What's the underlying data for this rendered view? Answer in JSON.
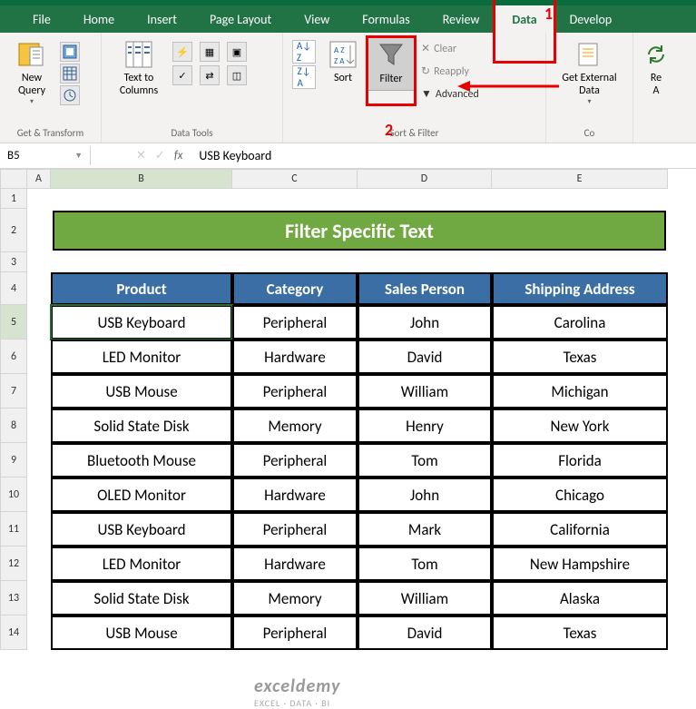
{
  "ribbon": {
    "tabs": [
      "File",
      "Home",
      "Insert",
      "Page Layout",
      "View",
      "Formulas",
      "Review",
      "Data",
      "Develop"
    ],
    "active_tab": "Data",
    "groups": {
      "get_transform": {
        "label": "Get & Transform",
        "new_query": "New\nQuery"
      },
      "data_tools": {
        "label": "Data Tools",
        "text_to_columns": "Text to\nColumns"
      },
      "sort_filter": {
        "label": "Sort & Filter",
        "sort": "Sort",
        "filter": "Filter",
        "clear": "Clear",
        "reapply": "Reapply",
        "advanced": "Advanced"
      },
      "get_external": {
        "label": "Co",
        "btn": "Get External\nData"
      },
      "refresh": {
        "label": "",
        "btn": "Re\nA"
      }
    }
  },
  "annotations": {
    "one": "1",
    "two": "2"
  },
  "name_box": "B5",
  "formula_value": "USB Keyboard",
  "columns": [
    "A",
    "B",
    "C",
    "D",
    "E"
  ],
  "row_count": 14,
  "selected_row": 5,
  "sheet_title": "Filter Specific Text",
  "table": {
    "headers": [
      "Product",
      "Category",
      "Sales Person",
      "Shipping Address"
    ],
    "rows": [
      [
        "USB Keyboard",
        "Peripheral",
        "John",
        "Carolina"
      ],
      [
        "LED Monitor",
        "Hardware",
        "David",
        "Texas"
      ],
      [
        "USB Mouse",
        "Peripheral",
        "William",
        "Michigan"
      ],
      [
        "Solid State Disk",
        "Memory",
        "Henry",
        "New York"
      ],
      [
        "Bluetooth Mouse",
        "Peripheral",
        "Tom",
        "Florida"
      ],
      [
        "OLED Monitor",
        "Hardware",
        "John",
        "Chicago"
      ],
      [
        "USB Keyboard",
        "Peripheral",
        "Mark",
        "California"
      ],
      [
        "LED Monitor",
        "Hardware",
        "Tom",
        "New Hampshire"
      ],
      [
        "Solid State Disk",
        "Memory",
        "William",
        "Alaska"
      ],
      [
        "USB Mouse",
        "Peripheral",
        "David",
        "Texas"
      ]
    ]
  },
  "watermark": {
    "brand": "exceldemy",
    "tag": "EXCEL · DATA · BI"
  }
}
